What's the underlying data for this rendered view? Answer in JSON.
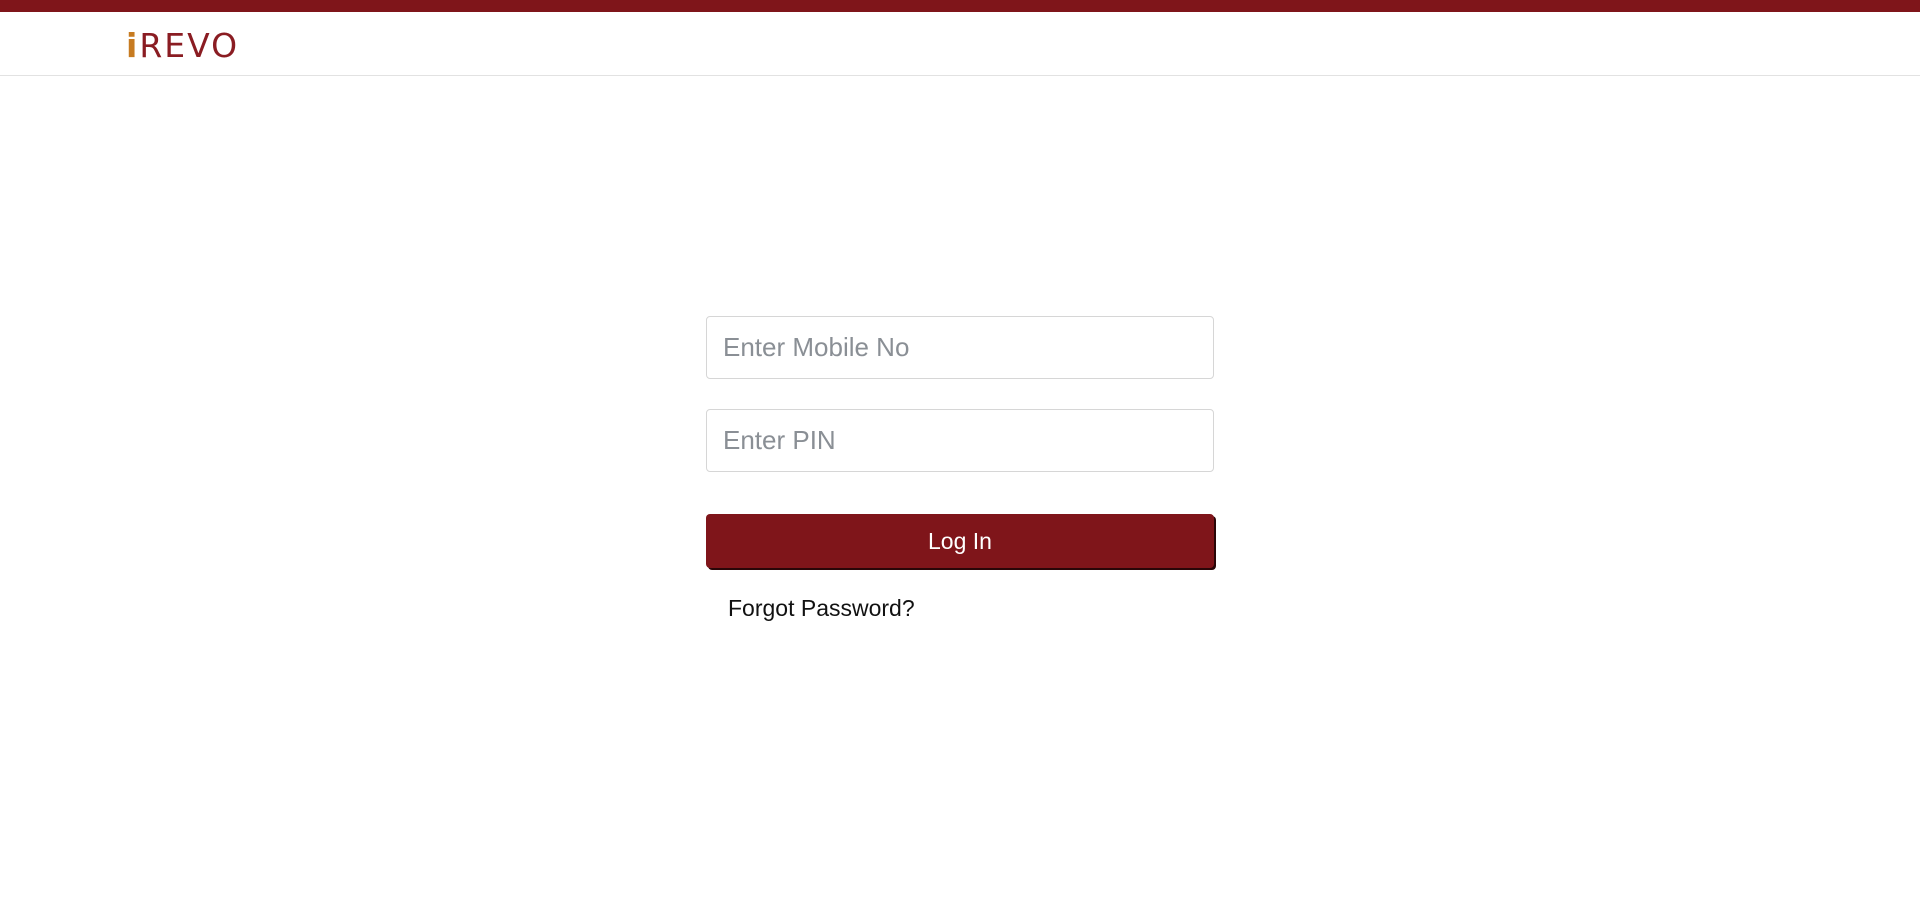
{
  "brand": {
    "logo_i": "i",
    "logo_rest": "REVO",
    "primary_color": "#7f151a",
    "accent_color": "#c77b21"
  },
  "login": {
    "mobile_placeholder": "Enter Mobile No",
    "mobile_value": "",
    "pin_placeholder": "Enter PIN",
    "pin_value": "",
    "submit_label": "Log In",
    "forgot_label": "Forgot Password?"
  }
}
